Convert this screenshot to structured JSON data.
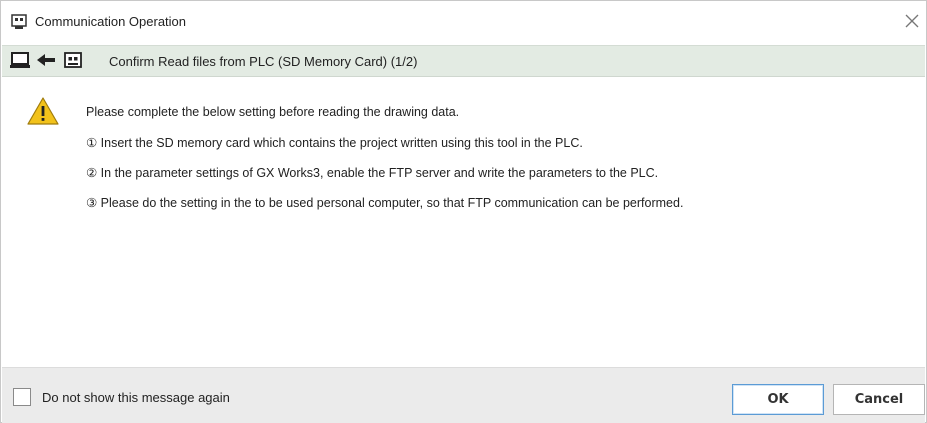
{
  "window": {
    "title": "Communication Operation",
    "title_icon": "plc-icon",
    "close_icon": "close-icon"
  },
  "subheader": {
    "icons": [
      "computer-icon",
      "arrow-left-icon",
      "plc-icon"
    ],
    "text": "Confirm Read files from PLC (SD Memory Card) (1/2)"
  },
  "message": {
    "icon": "warning-icon",
    "lines": [
      "Please complete the below setting before reading the drawing data.",
      "① Insert the SD memory card which contains the project written using this tool in the PLC.",
      "② In the parameter settings of GX Works3, enable the FTP server and write the parameters to the PLC.",
      "③ Please do the setting in the to be used personal computer, so that FTP communication can be performed."
    ]
  },
  "footer": {
    "checkbox_label": "Do not show this message again",
    "checkbox_checked": false,
    "ok_label": "OK",
    "cancel_label": "Cancel"
  },
  "colors": {
    "subheader_bg": "#e3ebe3",
    "footer_bg": "#ebebeb",
    "warning_yellow": "#f2c21b",
    "ok_border": "#5b9bd5"
  }
}
